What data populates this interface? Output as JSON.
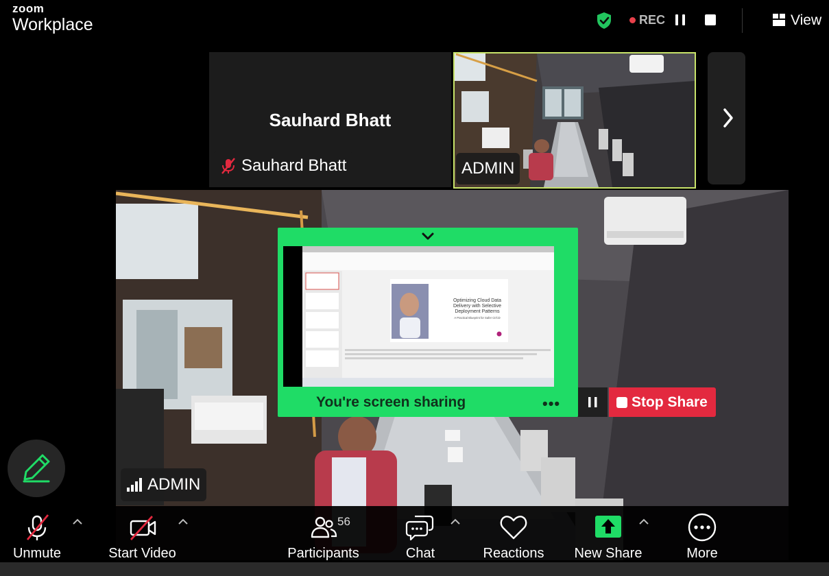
{
  "app": {
    "logo_line1": "zoom",
    "logo_line2": "Workplace"
  },
  "topbar": {
    "recording_label": "REC",
    "view_label": "View"
  },
  "participants_strip": {
    "tiles": [
      {
        "display_name": "Sauhard Bhatt",
        "name_tag": "Sauhard Bhatt",
        "muted": true
      },
      {
        "name_tag": "ADMIN"
      }
    ]
  },
  "main_video": {
    "name_tag": "ADMIN"
  },
  "share_banner": {
    "status_text": "You're screen sharing",
    "more_label": "•••",
    "stop_label": "Stop Share",
    "slide": {
      "title": "Optimizing Cloud Data Delivery with Selective Deployment Patterns",
      "subtitle": "A Practical Blueprint for Safer CI/CD"
    }
  },
  "toolbar": {
    "unmute_label": "Unmute",
    "start_video_label": "Start Video",
    "participants_label": "Participants",
    "participants_count": "56",
    "chat_label": "Chat",
    "reactions_label": "Reactions",
    "new_share_label": "New Share",
    "more_label": "More"
  },
  "colors": {
    "share_green": "#1fdc66",
    "stop_red": "#e3293f",
    "active_speaker_border": "#c9e46a",
    "shield_green": "#22c55e",
    "rec_red": "#e8404a"
  }
}
